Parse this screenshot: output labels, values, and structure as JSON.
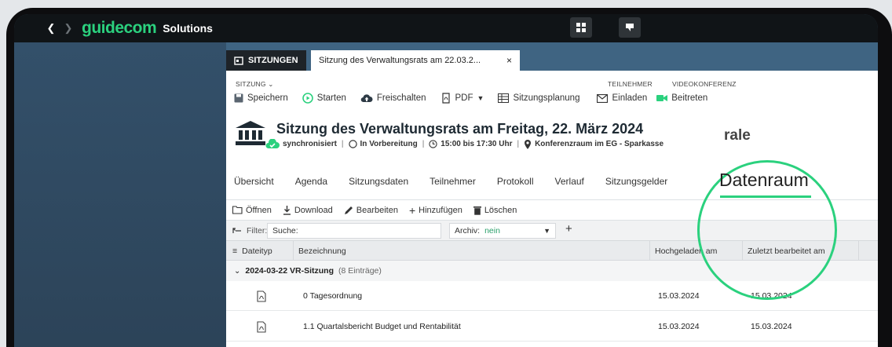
{
  "topbar": {
    "back_icon": "chevron-left-icon",
    "forward_icon": "chevron-right-icon",
    "logo_text": "guidecom",
    "logo_subtext": "Solutions",
    "brand_color": "#2bd17e"
  },
  "tabs": {
    "sitzungen_label": "SITZUNGEN",
    "meeting_tab_label": "Sitzung des Verwaltungsrats am 22.03.2...",
    "close_symbol": "×"
  },
  "toolbar_sections": {
    "sitzung": "SITZUNG ⌄",
    "teilnehmer": "TEILNEHMER",
    "videokonferenz": "VIDEOKONFERENZ"
  },
  "toolbar": {
    "save": "Speichern",
    "start": "Starten",
    "release": "Freischalten",
    "pdf": "PDF",
    "planning": "Sitzungsplanung",
    "invite": "Einladen",
    "join": "Beitreten"
  },
  "meeting": {
    "title": "Sitzung des Verwaltungsrats am Freitag, 22. März 2024",
    "sync_status": "synchronisiert",
    "phase": "In Vorbereitung",
    "time": "15:00 bis 17:30 Uhr",
    "location": "Konferenzraum im EG - Sparkasse",
    "partial_heading": "rale"
  },
  "nav_tabs": [
    "Übersicht",
    "Agenda",
    "Sitzungsdaten",
    "Teilnehmer",
    "Protokoll",
    "Verlauf",
    "Sitzungsgelder"
  ],
  "highlight_tab": "Datenraum",
  "actions": {
    "open": "Öffnen",
    "download": "Download",
    "edit": "Bearbeiten",
    "add": "Hinzufügen",
    "delete": "Löschen"
  },
  "filter": {
    "label": "Filter:",
    "search_label": "Suche:",
    "archive_label": "Archiv:",
    "archive_value": "nein",
    "add_symbol": "+"
  },
  "table": {
    "columns": {
      "type": "Dateityp",
      "name": "Bezeichnung",
      "uploaded": "Hochgeladen am",
      "edited": "Zuletzt bearbeitet am"
    },
    "group": {
      "label": "2024-03-22 VR-Sitzung",
      "count": "(8 Einträge)"
    },
    "rows": [
      {
        "name": "0 Tagesordnung",
        "uploaded": "15.03.2024",
        "edited": "15.03.2024",
        "type_icon": "pdf-icon"
      },
      {
        "name": "1.1 Quartalsbericht Budget und Rentabilität",
        "uploaded": "15.03.2024",
        "edited": "15.03.2024",
        "type_icon": "pdf-icon"
      }
    ]
  }
}
